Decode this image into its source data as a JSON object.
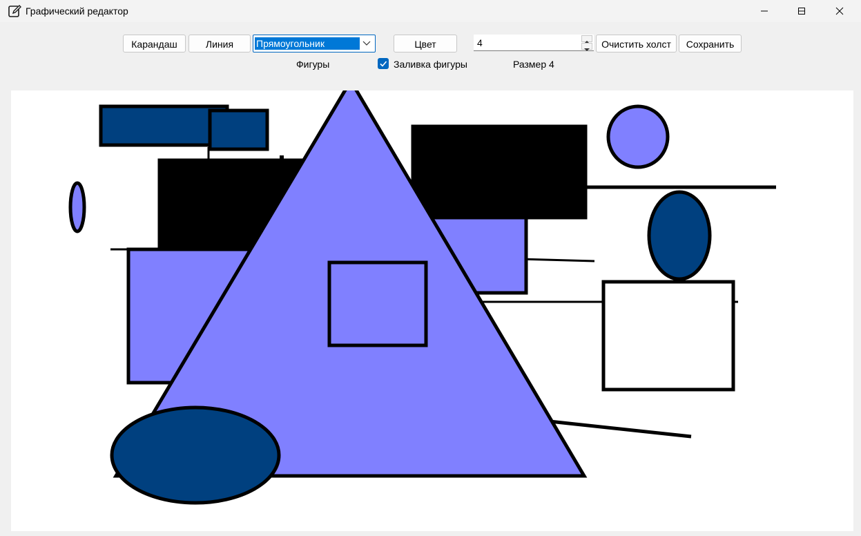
{
  "window": {
    "title": "Графический редактор",
    "icon": "edit-icon"
  },
  "toolbar": {
    "pencil_label": "Карандаш",
    "line_label": "Линия",
    "shape_select_value": "Прямоугольник",
    "color_label": "Цвет",
    "size_value": "4",
    "clear_label": "Очистить холст",
    "save_label": "Сохранить"
  },
  "labels": {
    "shapes": "Фигуры",
    "fill": "Заливка фигуры",
    "size": "Размер 4"
  },
  "fill_checked": true,
  "colors": {
    "fill_light": "#8080ff",
    "fill_dark": "#00407f",
    "stroke": "#000000",
    "accent": "#0067c0"
  }
}
